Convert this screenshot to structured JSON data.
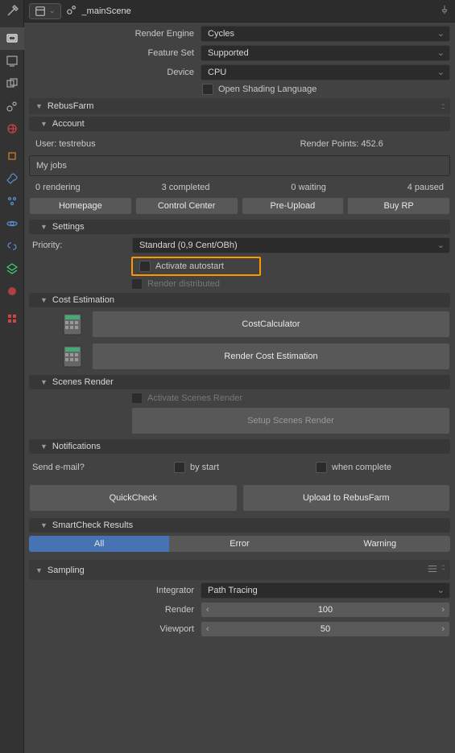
{
  "scene_name": "_mainScene",
  "render": {
    "engine_label": "Render Engine",
    "engine_value": "Cycles",
    "feature_label": "Feature Set",
    "feature_value": "Supported",
    "device_label": "Device",
    "device_value": "CPU",
    "osl_label": "Open Shading Language"
  },
  "rebusfarm": {
    "title": "RebusFarm",
    "account": {
      "title": "Account",
      "user_label": "User: testrebus",
      "points_label": "Render Points: 452.6",
      "jobs_title": "My jobs",
      "stats": [
        "0 rendering",
        "3 completed",
        "0 waiting",
        "4 paused"
      ],
      "buttons": [
        "Homepage",
        "Control Center",
        "Pre-Upload",
        "Buy RP"
      ]
    },
    "settings": {
      "title": "Settings",
      "priority_label": "Priority:",
      "priority_value": "Standard (0,9 Cent/OBh)",
      "autostart_label": "Activate autostart",
      "distributed_label": "Render distributed"
    },
    "cost": {
      "title": "Cost Estimation",
      "calculator_btn": "CostCalculator",
      "estimation_btn": "Render Cost Estimation"
    },
    "scenes": {
      "title": "Scenes Render",
      "activate_label": "Activate Scenes Render",
      "setup_btn": "Setup Scenes Render"
    },
    "notifications": {
      "title": "Notifications",
      "email_label": "Send e-mail?",
      "by_start": "by start",
      "when_complete": "when complete"
    },
    "actions": {
      "quickcheck": "QuickCheck",
      "upload": "Upload to RebusFarm"
    },
    "smartcheck": {
      "title": "SmartCheck Results",
      "filters": [
        "All",
        "Error",
        "Warning"
      ]
    }
  },
  "sampling": {
    "title": "Sampling",
    "integrator_label": "Integrator",
    "integrator_value": "Path Tracing",
    "render_label": "Render",
    "render_value": "100",
    "viewport_label": "Viewport",
    "viewport_value": "50"
  }
}
